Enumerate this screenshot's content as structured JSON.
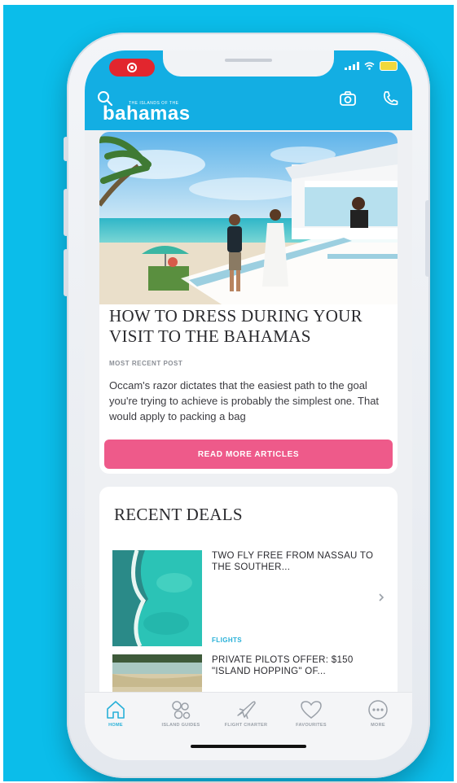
{
  "colors": {
    "background": "#0bbdea",
    "header": "#13aee3",
    "accent_pink": "#ee5a8a",
    "accent_blue": "#27b0d8",
    "record_red": "#e2262e"
  },
  "header": {
    "logo_main": "bahamas",
    "logo_tag": "THE ISLANDS OF THE",
    "icons": [
      "search-icon",
      "camera-icon",
      "phone-icon"
    ]
  },
  "article": {
    "title": "HOW TO DRESS DURING YOUR VISIT TO THE BAHAMAS",
    "meta": "MOST RECENT POST",
    "excerpt": "Occam's razor dictates that the easiest path to the goal you're trying to achieve is probably the simplest one. That would apply to packing a bag",
    "button": "READ MORE ARTICLES"
  },
  "deals": {
    "title": "RECENT DEALS",
    "items": [
      {
        "name": "TWO FLY FREE FROM NASSAU TO THE SOUTHER...",
        "category": "FLIGHTS"
      },
      {
        "name": "PRIVATE PILOTS OFFER: $150 \"ISLAND HOPPING\" OF...",
        "category": ""
      }
    ]
  },
  "tabs": [
    {
      "label": "HOME",
      "icon": "home-icon",
      "active": true
    },
    {
      "label": "ISLAND GUIDES",
      "icon": "islands-icon",
      "active": false
    },
    {
      "label": "FLIGHT CHARTER",
      "icon": "plane-icon",
      "active": false
    },
    {
      "label": "FAVOURITES",
      "icon": "heart-icon",
      "active": false
    },
    {
      "label": "MORE",
      "icon": "more-icon",
      "active": false
    }
  ]
}
